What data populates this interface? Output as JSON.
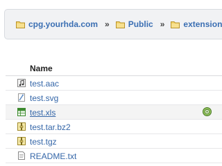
{
  "breadcrumb": {
    "items": [
      {
        "label": "cpg.yourhda.com",
        "icon": "folder-icon"
      },
      {
        "label": "Public",
        "icon": "folder-icon"
      },
      {
        "label": "extensions",
        "icon": "folder-icon"
      }
    ],
    "separator": "»"
  },
  "table": {
    "column_name": "Name",
    "files": [
      {
        "name": "test.aac",
        "icon": "audio-file-icon"
      },
      {
        "name": "test.svg",
        "icon": "vector-file-icon"
      },
      {
        "name": "test.xls",
        "icon": "spreadsheet-file-icon"
      },
      {
        "name": "test.tar.bz2",
        "icon": "archive-file-icon"
      },
      {
        "name": "test.tgz",
        "icon": "archive-file-icon"
      },
      {
        "name": "README.txt",
        "icon": "text-file-icon"
      }
    ]
  },
  "colors": {
    "link": "#3466a8",
    "breadcrumb_bg": "#f1f2f4",
    "folder": "#e8c24a"
  }
}
